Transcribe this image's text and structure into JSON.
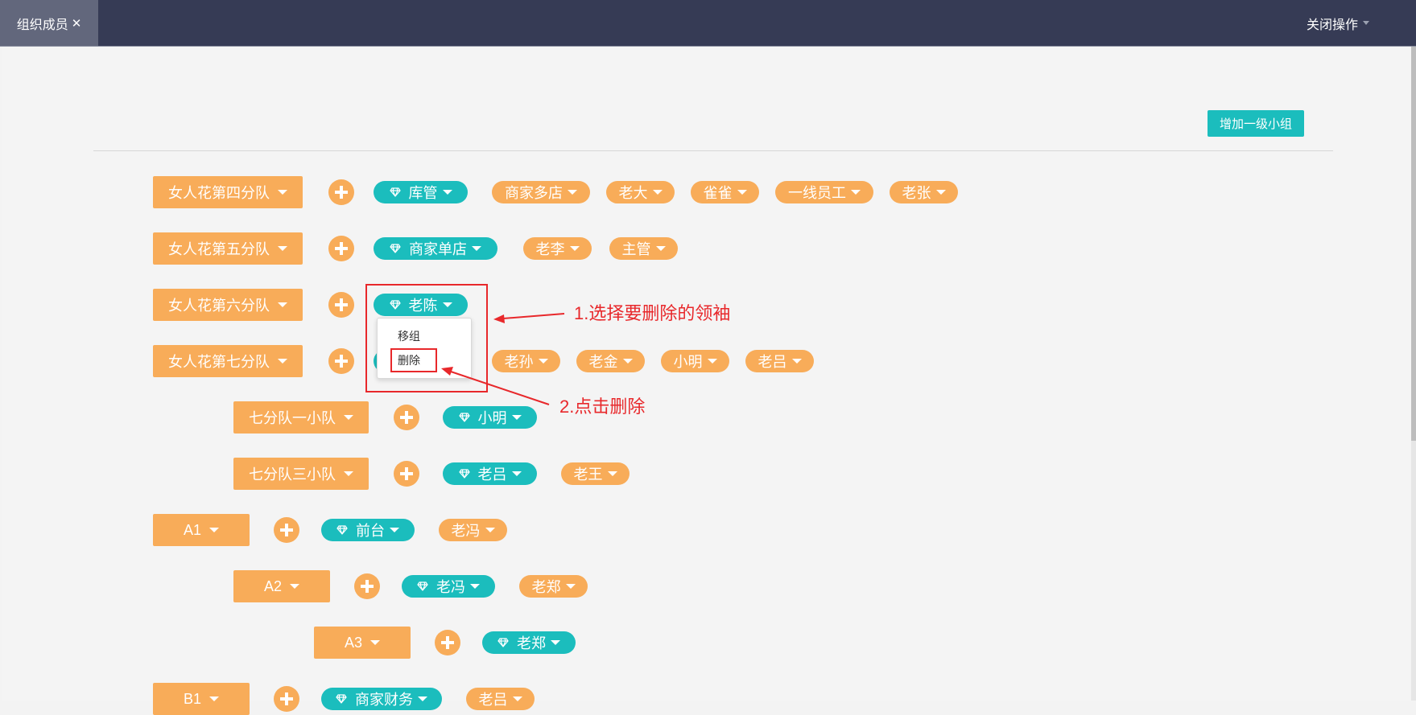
{
  "tabs": {
    "active_label": "组织成员",
    "close_glyph": "✕"
  },
  "header": {
    "close_ops_label": "关闭操作"
  },
  "toolbar": {
    "add_group_label": "增加一级小组"
  },
  "groups": [
    {
      "name": "女人花第四分队",
      "leader": "库管",
      "members": [
        "商家多店",
        "老大",
        "雀雀",
        "一线员工",
        "老张"
      ]
    },
    {
      "name": "女人花第五分队",
      "leader": "商家单店",
      "members": [
        "老李",
        "主管"
      ]
    },
    {
      "name": "女人花第六分队",
      "leader": "老陈",
      "members": []
    },
    {
      "name": "女人花第七分队",
      "leader": "",
      "members": [
        "老孙",
        "老金",
        "小明",
        "老吕"
      ]
    },
    {
      "name": "七分队一小队",
      "leader": "小明",
      "members": []
    },
    {
      "name": "七分队三小队",
      "leader": "老吕",
      "members": [
        "老王"
      ]
    },
    {
      "name": "A1",
      "leader": "前台",
      "members": [
        "老冯"
      ]
    },
    {
      "name": "A2",
      "leader": "老冯",
      "members": [
        "老郑"
      ]
    },
    {
      "name": "A3",
      "leader": "老郑",
      "members": []
    },
    {
      "name": "B1",
      "leader": "商家财务",
      "members": [
        "老吕"
      ]
    }
  ],
  "dropdown": {
    "items": [
      "移组",
      "删除"
    ]
  },
  "annotations": {
    "step1": "1.选择要删除的领袖",
    "step2": "2.点击删除"
  },
  "colors": {
    "orange": "#f8ac59",
    "teal": "#1bbdbd",
    "navbar": "#363b55",
    "annotation_red": "#e8282b"
  },
  "icons": {
    "leader": "diamond-icon",
    "add": "plus-circle-icon",
    "dropdown": "caret-down-icon"
  }
}
